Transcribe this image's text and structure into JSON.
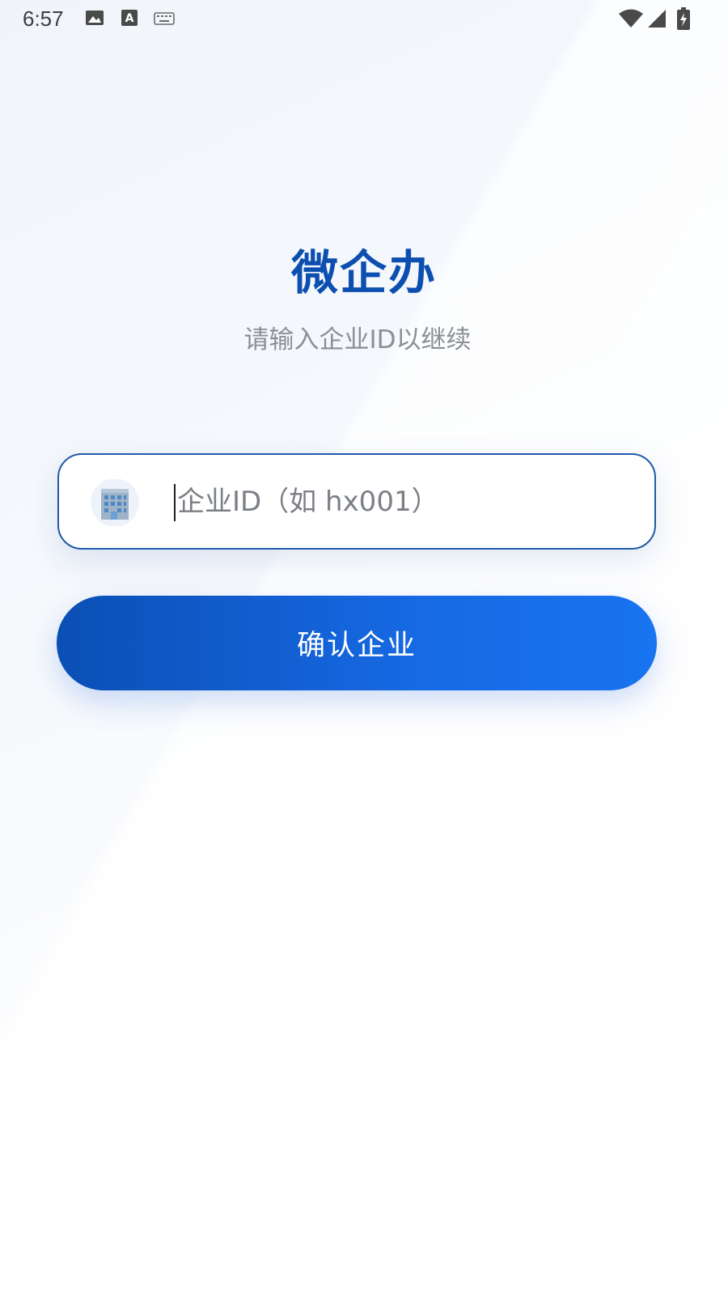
{
  "status_bar": {
    "time": "6:57",
    "icons": [
      "gallery-icon",
      "font-a-icon",
      "keyboard-icon",
      "wifi-icon",
      "cellular-signal-icon",
      "battery-charging-icon"
    ]
  },
  "app": {
    "title": "微企办",
    "subtitle": "请输入企业ID以继续"
  },
  "enterprise_field": {
    "icon": "office-building-icon",
    "value": "",
    "placeholder": "企业ID（如 hx001）"
  },
  "confirm_button": {
    "label": "确认企业"
  },
  "colors": {
    "brand": "#0d4fb0",
    "field_border": "#1f5aa8",
    "button_start": "#0b4fb5",
    "button_end": "#1874f0",
    "subtitle": "#8a8e96"
  }
}
